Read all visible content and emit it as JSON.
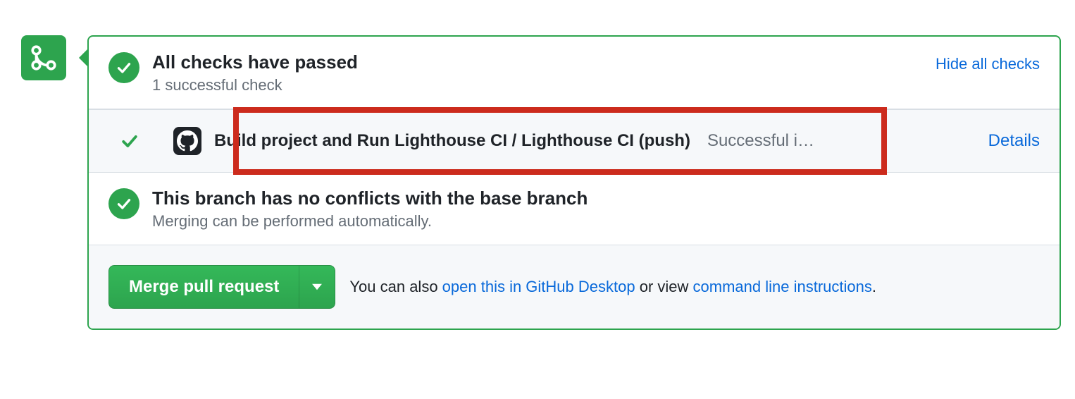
{
  "checks_summary": {
    "title": "All checks have passed",
    "subtitle": "1 successful check",
    "toggle_label": "Hide all checks"
  },
  "check_item": {
    "name": "Build project and Run Lighthouse CI / Lighthouse CI (push)",
    "status": "Successful i…",
    "details_label": "Details"
  },
  "conflicts": {
    "title": "This branch has no conflicts with the base branch",
    "subtitle": "Merging can be performed automatically."
  },
  "footer": {
    "merge_button": "Merge pull request",
    "text_prefix": "You can also ",
    "link_desktop": "open this in GitHub Desktop",
    "text_middle": " or view ",
    "link_cli": "command line instructions",
    "text_suffix": "."
  }
}
